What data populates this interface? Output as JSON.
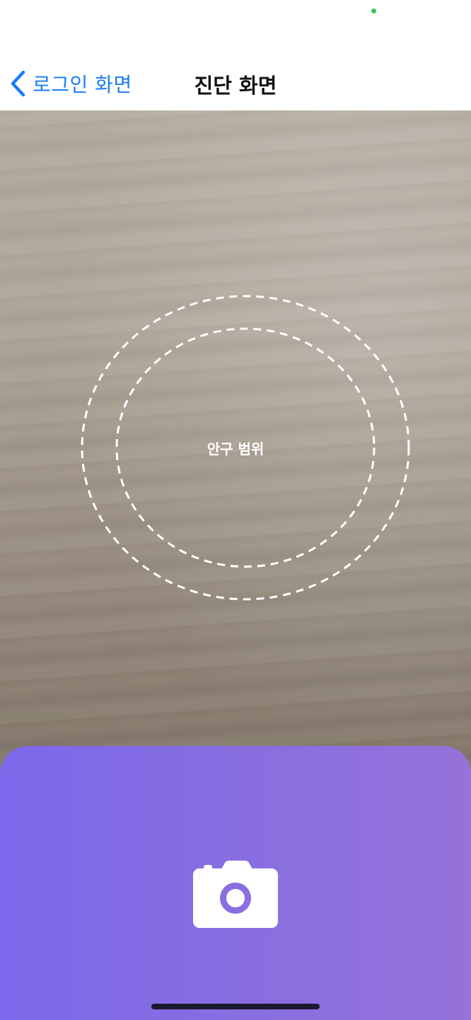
{
  "nav": {
    "back_label": "로그인 화면",
    "title": "진단 화면"
  },
  "camera": {
    "guide_label": "안구 범위"
  },
  "icons": {
    "back": "chevron-left-icon",
    "capture": "camera-icon"
  },
  "colors": {
    "accent": "#1a7cf5",
    "panel_start": "#7b68ea",
    "panel_end": "#9672da",
    "privacy_dot": "#34c759"
  }
}
